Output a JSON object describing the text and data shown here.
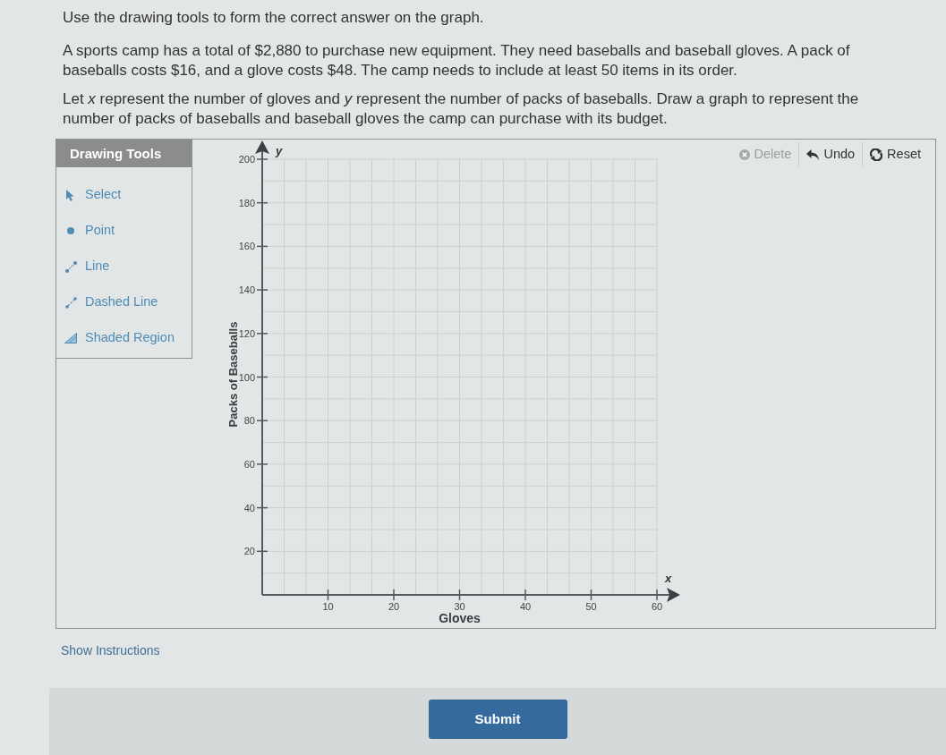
{
  "question": {
    "prompt": "Use the drawing tools to form the correct answer on the graph.",
    "paragraphs": [
      "A sports camp has a total of $2,880 to purchase new equipment. They need baseballs and baseball gloves. A pack of baseballs costs $16, and a glove costs $48. The camp needs to include at least 50 items in its order.",
      "Let *x* represent the number of gloves and *y* represent the number of packs of baseballs. Draw a graph to represent the number of packs of baseballs and baseball gloves the camp can purchase with its budget."
    ]
  },
  "drawing_tools": {
    "title": "Drawing Tools",
    "items": [
      {
        "label": "Select",
        "kind": "select",
        "selected": false
      },
      {
        "label": "Point",
        "kind": "point",
        "selected": false
      },
      {
        "label": "Line",
        "kind": "line",
        "selected": false
      },
      {
        "label": "Dashed Line",
        "kind": "dashed_line",
        "selected": false
      },
      {
        "label": "Shaded Region",
        "kind": "shaded_region",
        "selected": false
      }
    ]
  },
  "toolbar": [
    {
      "label": "Delete",
      "kind": "delete",
      "disabled": true
    },
    {
      "label": "Undo",
      "kind": "undo",
      "disabled": false
    },
    {
      "label": "Reset",
      "kind": "reset",
      "disabled": false
    }
  ],
  "graph": {
    "x_axis_letter": "x",
    "y_axis_letter": "y",
    "chart_data": {
      "type": "scatter",
      "xlabel": "Gloves",
      "ylabel": "Packs of Baseballs",
      "xlim": [
        0,
        60
      ],
      "ylim": [
        0,
        200
      ],
      "xticks": [
        10,
        20,
        30,
        40,
        50,
        60
      ],
      "yticks": [
        20,
        40,
        60,
        80,
        100,
        120,
        140,
        160,
        180,
        200
      ],
      "grid": true
    }
  },
  "show_instructions": "Show Instructions",
  "submit": "Submit"
}
